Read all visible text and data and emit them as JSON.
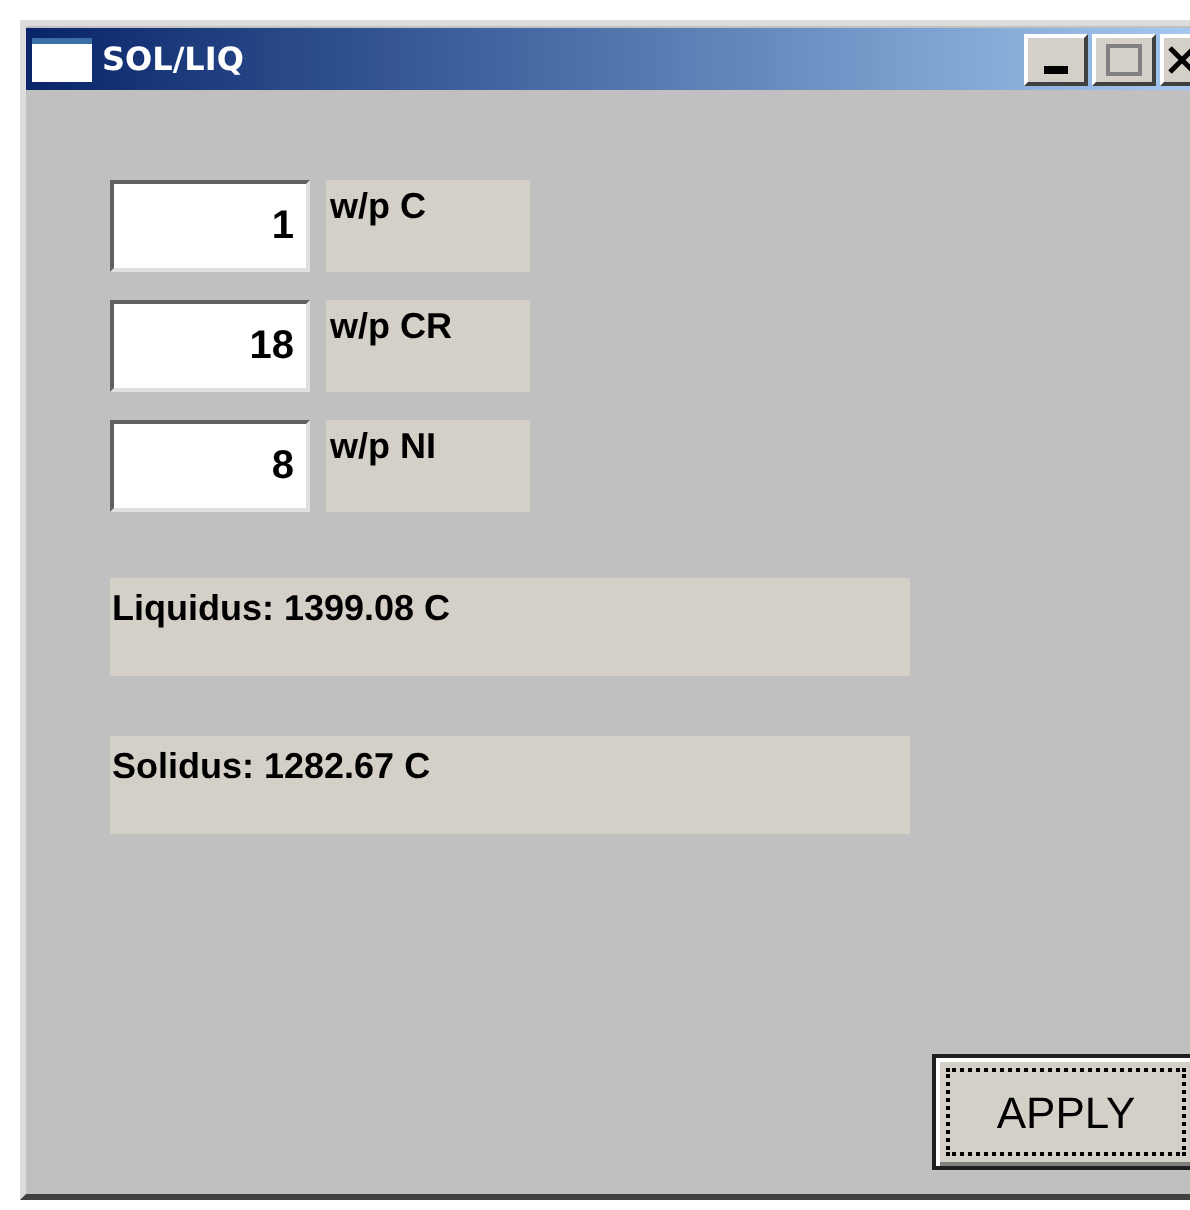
{
  "window": {
    "title": "SOL/LIQ"
  },
  "inputs": [
    {
      "value": "1",
      "label": "w/p C"
    },
    {
      "value": "18",
      "label": "w/p CR"
    },
    {
      "value": "8",
      "label": "w/p NI"
    }
  ],
  "results": [
    "Liquidus: 1399.08 C",
    "Solidus: 1282.67 C"
  ],
  "apply_button": {
    "label": "APPLY",
    "focused": true
  }
}
